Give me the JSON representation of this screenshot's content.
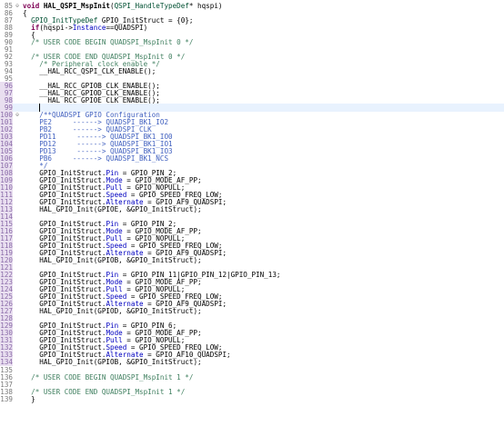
{
  "editor": {
    "lines": [
      {
        "num": "85",
        "fold": "⊖",
        "changed": false,
        "segments": [
          {
            "t": "void ",
            "c": "t-kw"
          },
          {
            "t": "HAL_QSPI_MspInit",
            "c": "t-fn"
          },
          {
            "t": "(",
            "c": "t-plain"
          },
          {
            "t": "QSPI_HandleTypeDef",
            "c": "t-type"
          },
          {
            "t": "* hqspi)",
            "c": "t-plain"
          }
        ]
      },
      {
        "num": "86",
        "segments": [
          {
            "t": "{",
            "c": "t-plain"
          }
        ]
      },
      {
        "num": "87",
        "segments": [
          {
            "t": "  ",
            "c": "t-plain"
          },
          {
            "t": "GPIO_InitTypeDef",
            "c": "t-type"
          },
          {
            "t": " GPIO_InitStruct = {0};",
            "c": "t-plain"
          }
        ]
      },
      {
        "num": "88",
        "segments": [
          {
            "t": "  ",
            "c": "t-plain"
          },
          {
            "t": "if",
            "c": "t-kw"
          },
          {
            "t": "(hqspi->",
            "c": "t-plain"
          },
          {
            "t": "Instance",
            "c": "t-field"
          },
          {
            "t": "==QUADSPI)",
            "c": "t-plain"
          }
        ]
      },
      {
        "num": "89",
        "segments": [
          {
            "t": "  {",
            "c": "t-plain"
          }
        ]
      },
      {
        "num": "90",
        "segments": [
          {
            "t": "  /* USER CODE BEGIN QUADSPI_MspInit 0 */",
            "c": "t-comment"
          }
        ]
      },
      {
        "num": "91",
        "segments": []
      },
      {
        "num": "92",
        "segments": [
          {
            "t": "  /* USER CODE END QUADSPI_MspInit 0 */",
            "c": "t-comment"
          }
        ]
      },
      {
        "num": "93",
        "segments": [
          {
            "t": "    /* Peripheral clock enable */",
            "c": "t-comment"
          }
        ]
      },
      {
        "num": "94",
        "segments": [
          {
            "t": "    __HAL_RCC_QSPI_CLK_ENABLE();",
            "c": "t-plain"
          }
        ]
      },
      {
        "num": "95",
        "segments": []
      },
      {
        "num": "96",
        "changed": true,
        "segments": [
          {
            "t": "    __HAL_RCC_GPIOB_CLK_ENABLE();",
            "c": "t-plain"
          }
        ]
      },
      {
        "num": "97",
        "changed": true,
        "segments": [
          {
            "t": "    __HAL_RCC_GPIOD_CLK_ENABLE();",
            "c": "t-plain"
          }
        ]
      },
      {
        "num": "98",
        "changed": true,
        "segments": [
          {
            "t": "    __HAL_RCC_GPIOE_CLK_ENABLE();",
            "c": "t-plain"
          }
        ]
      },
      {
        "num": "99",
        "changed": true,
        "current": true,
        "segments": [
          {
            "t": "    ",
            "c": "t-plain"
          }
        ]
      },
      {
        "num": "100",
        "fold": "⊖",
        "changed": true,
        "segments": [
          {
            "t": "    /**QUADSPI GPIO Configuration",
            "c": "t-link"
          }
        ]
      },
      {
        "num": "101",
        "changed": true,
        "segments": [
          {
            "t": "    PE2     ------> QUADSPI_BK1_IO2",
            "c": "t-link"
          }
        ]
      },
      {
        "num": "102",
        "changed": true,
        "segments": [
          {
            "t": "    PB2     ------> QUADSPI_CLK",
            "c": "t-link"
          }
        ]
      },
      {
        "num": "103",
        "changed": true,
        "segments": [
          {
            "t": "    PD11     ------> QUADSPI_BK1_IO0",
            "c": "t-link"
          }
        ]
      },
      {
        "num": "104",
        "changed": true,
        "segments": [
          {
            "t": "    PD12     ------> QUADSPI_BK1_IO1",
            "c": "t-link"
          }
        ]
      },
      {
        "num": "105",
        "changed": true,
        "segments": [
          {
            "t": "    PD13     ------> QUADSPI_BK1_IO3",
            "c": "t-link"
          }
        ]
      },
      {
        "num": "106",
        "changed": true,
        "segments": [
          {
            "t": "    PB6     ------> QUADSPI_BK1_NCS",
            "c": "t-link"
          }
        ]
      },
      {
        "num": "107",
        "changed": true,
        "segments": [
          {
            "t": "    */",
            "c": "t-link"
          }
        ]
      },
      {
        "num": "108",
        "changed": true,
        "segments": [
          {
            "t": "    GPIO_InitStruct.",
            "c": "t-plain"
          },
          {
            "t": "Pin",
            "c": "t-field"
          },
          {
            "t": " = GPIO_PIN_2;",
            "c": "t-plain"
          }
        ]
      },
      {
        "num": "109",
        "changed": true,
        "segments": [
          {
            "t": "    GPIO_InitStruct.",
            "c": "t-plain"
          },
          {
            "t": "Mode",
            "c": "t-field"
          },
          {
            "t": " = GPIO_MODE_AF_PP;",
            "c": "t-plain"
          }
        ]
      },
      {
        "num": "110",
        "changed": true,
        "segments": [
          {
            "t": "    GPIO_InitStruct.",
            "c": "t-plain"
          },
          {
            "t": "Pull",
            "c": "t-field"
          },
          {
            "t": " = GPIO_NOPULL;",
            "c": "t-plain"
          }
        ]
      },
      {
        "num": "111",
        "changed": true,
        "segments": [
          {
            "t": "    GPIO_InitStruct.",
            "c": "t-plain"
          },
          {
            "t": "Speed",
            "c": "t-field"
          },
          {
            "t": " = GPIO_SPEED_FREQ_LOW;",
            "c": "t-plain"
          }
        ]
      },
      {
        "num": "112",
        "changed": true,
        "segments": [
          {
            "t": "    GPIO_InitStruct.",
            "c": "t-plain"
          },
          {
            "t": "Alternate",
            "c": "t-field"
          },
          {
            "t": " = GPIO_AF9_QUADSPI;",
            "c": "t-plain"
          }
        ]
      },
      {
        "num": "113",
        "changed": true,
        "segments": [
          {
            "t": "    HAL_GPIO_Init(GPIOE, &GPIO_InitStruct);",
            "c": "t-plain"
          }
        ]
      },
      {
        "num": "114",
        "changed": true,
        "segments": []
      },
      {
        "num": "115",
        "changed": true,
        "segments": [
          {
            "t": "    GPIO_InitStruct.",
            "c": "t-plain"
          },
          {
            "t": "Pin",
            "c": "t-field"
          },
          {
            "t": " = GPIO_PIN_2;",
            "c": "t-plain"
          }
        ]
      },
      {
        "num": "116",
        "changed": true,
        "segments": [
          {
            "t": "    GPIO_InitStruct.",
            "c": "t-plain"
          },
          {
            "t": "Mode",
            "c": "t-field"
          },
          {
            "t": " = GPIO_MODE_AF_PP;",
            "c": "t-plain"
          }
        ]
      },
      {
        "num": "117",
        "changed": true,
        "segments": [
          {
            "t": "    GPIO_InitStruct.",
            "c": "t-plain"
          },
          {
            "t": "Pull",
            "c": "t-field"
          },
          {
            "t": " = GPIO_NOPULL;",
            "c": "t-plain"
          }
        ]
      },
      {
        "num": "118",
        "changed": true,
        "segments": [
          {
            "t": "    GPIO_InitStruct.",
            "c": "t-plain"
          },
          {
            "t": "Speed",
            "c": "t-field"
          },
          {
            "t": " = GPIO_SPEED_FREQ_LOW;",
            "c": "t-plain"
          }
        ]
      },
      {
        "num": "119",
        "changed": true,
        "segments": [
          {
            "t": "    GPIO_InitStruct.",
            "c": "t-plain"
          },
          {
            "t": "Alternate",
            "c": "t-field"
          },
          {
            "t": " = GPIO_AF9_QUADSPI;",
            "c": "t-plain"
          }
        ]
      },
      {
        "num": "120",
        "changed": true,
        "segments": [
          {
            "t": "    HAL_GPIO_Init(GPIOB, &GPIO_InitStruct);",
            "c": "t-plain"
          }
        ]
      },
      {
        "num": "121",
        "changed": true,
        "segments": []
      },
      {
        "num": "122",
        "changed": true,
        "segments": [
          {
            "t": "    GPIO_InitStruct.",
            "c": "t-plain"
          },
          {
            "t": "Pin",
            "c": "t-field"
          },
          {
            "t": " = GPIO_PIN_11|GPIO_PIN_12|GPIO_PIN_13;",
            "c": "t-plain"
          }
        ]
      },
      {
        "num": "123",
        "changed": true,
        "segments": [
          {
            "t": "    GPIO_InitStruct.",
            "c": "t-plain"
          },
          {
            "t": "Mode",
            "c": "t-field"
          },
          {
            "t": " = GPIO_MODE_AF_PP;",
            "c": "t-plain"
          }
        ]
      },
      {
        "num": "124",
        "changed": true,
        "segments": [
          {
            "t": "    GPIO_InitStruct.",
            "c": "t-plain"
          },
          {
            "t": "Pull",
            "c": "t-field"
          },
          {
            "t": " = GPIO_NOPULL;",
            "c": "t-plain"
          }
        ]
      },
      {
        "num": "125",
        "changed": true,
        "segments": [
          {
            "t": "    GPIO_InitStruct.",
            "c": "t-plain"
          },
          {
            "t": "Speed",
            "c": "t-field"
          },
          {
            "t": " = GPIO_SPEED_FREQ_LOW;",
            "c": "t-plain"
          }
        ]
      },
      {
        "num": "126",
        "changed": true,
        "segments": [
          {
            "t": "    GPIO_InitStruct.",
            "c": "t-plain"
          },
          {
            "t": "Alternate",
            "c": "t-field"
          },
          {
            "t": " = GPIO_AF9_QUADSPI;",
            "c": "t-plain"
          }
        ]
      },
      {
        "num": "127",
        "changed": true,
        "segments": [
          {
            "t": "    HAL_GPIO_Init(GPIOD, &GPIO_InitStruct);",
            "c": "t-plain"
          }
        ]
      },
      {
        "num": "128",
        "changed": true,
        "segments": []
      },
      {
        "num": "129",
        "changed": true,
        "segments": [
          {
            "t": "    GPIO_InitStruct.",
            "c": "t-plain"
          },
          {
            "t": "Pin",
            "c": "t-field"
          },
          {
            "t": " = GPIO_PIN_6;",
            "c": "t-plain"
          }
        ]
      },
      {
        "num": "130",
        "changed": true,
        "segments": [
          {
            "t": "    GPIO_InitStruct.",
            "c": "t-plain"
          },
          {
            "t": "Mode",
            "c": "t-field"
          },
          {
            "t": " = GPIO_MODE_AF_PP;",
            "c": "t-plain"
          }
        ]
      },
      {
        "num": "131",
        "changed": true,
        "segments": [
          {
            "t": "    GPIO_InitStruct.",
            "c": "t-plain"
          },
          {
            "t": "Pull",
            "c": "t-field"
          },
          {
            "t": " = GPIO_NOPULL;",
            "c": "t-plain"
          }
        ]
      },
      {
        "num": "132",
        "changed": true,
        "segments": [
          {
            "t": "    GPIO_InitStruct.",
            "c": "t-plain"
          },
          {
            "t": "Speed",
            "c": "t-field"
          },
          {
            "t": " = GPIO_SPEED_FREQ_LOW;",
            "c": "t-plain"
          }
        ]
      },
      {
        "num": "133",
        "changed": true,
        "segments": [
          {
            "t": "    GPIO_InitStruct.",
            "c": "t-plain"
          },
          {
            "t": "Alternate",
            "c": "t-field"
          },
          {
            "t": " = GPIO_AF10_QUADSPI;",
            "c": "t-plain"
          }
        ]
      },
      {
        "num": "134",
        "changed": true,
        "segments": [
          {
            "t": "    HAL_GPIO_Init(GPIOB, &GPIO_InitStruct);",
            "c": "t-plain"
          }
        ]
      },
      {
        "num": "135",
        "segments": []
      },
      {
        "num": "136",
        "segments": [
          {
            "t": "  /* USER CODE BEGIN QUADSPI_MspInit 1 */",
            "c": "t-comment"
          }
        ]
      },
      {
        "num": "137",
        "segments": []
      },
      {
        "num": "138",
        "segments": [
          {
            "t": "  /* USER CODE END QUADSPI_MspInit 1 */",
            "c": "t-comment"
          }
        ]
      },
      {
        "num": "139",
        "segments": [
          {
            "t": "  }",
            "c": "t-plain"
          }
        ]
      }
    ]
  }
}
